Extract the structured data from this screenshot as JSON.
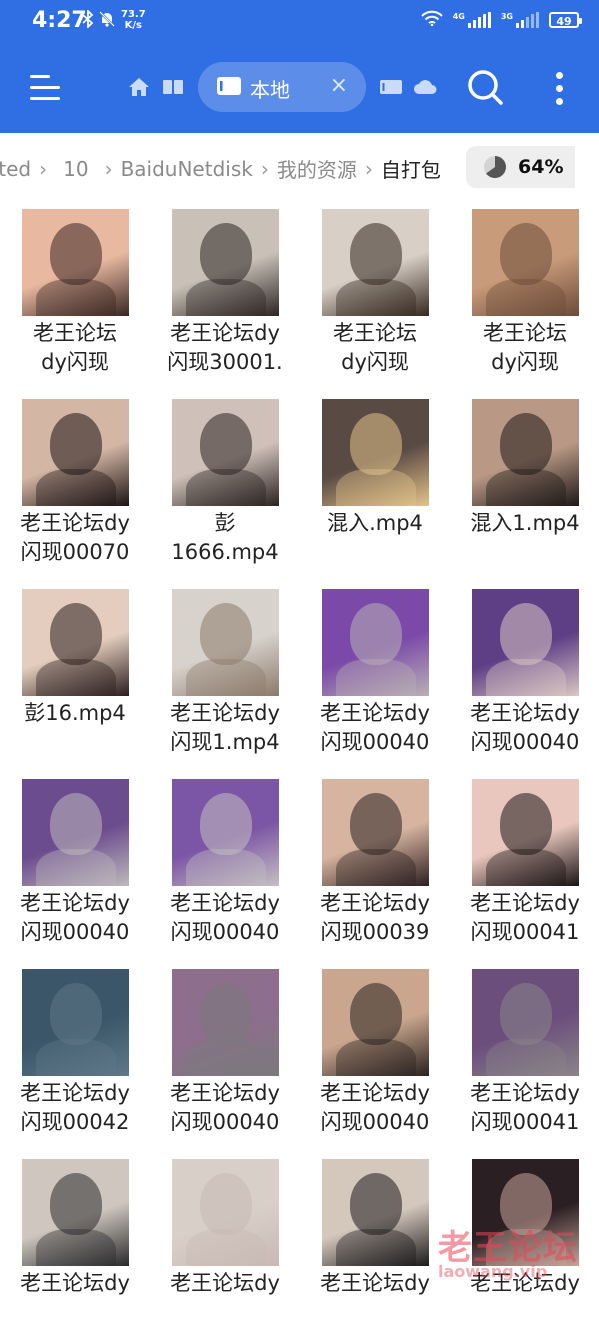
{
  "status_bar": {
    "time": "4:27",
    "net_speed_value": "73.7",
    "net_speed_unit": "K/s",
    "sim1_tag": "4G",
    "sim2_tag": "3G",
    "battery": "49"
  },
  "app_bar": {
    "active_tab_label": "本地",
    "tab_close": "×"
  },
  "breadcrumb": {
    "items": [
      "ated",
      "10",
      "BaiduNetdisk",
      "我的资源",
      "自打包"
    ],
    "separator": "›"
  },
  "storage": {
    "percent": "64%"
  },
  "files": [
    {
      "name_line1": "老王论坛",
      "name_line2": "dy闪现",
      "thumb": {
        "bg": "#e8b9a0",
        "fg": "#3a2622"
      }
    },
    {
      "name_line1": "老王论坛dy",
      "name_line2": "闪现30001.",
      "thumb": {
        "bg": "#c9c1b7",
        "fg": "#2c2624"
      }
    },
    {
      "name_line1": "老王论坛",
      "name_line2": "dy闪现",
      "thumb": {
        "bg": "#d8cfc6",
        "fg": "#35281f"
      }
    },
    {
      "name_line1": "老王论坛",
      "name_line2": "dy闪现",
      "thumb": {
        "bg": "#c89b7a",
        "fg": "#6c4b38"
      }
    },
    {
      "name_line1": "老王论坛dy",
      "name_line2": "闪现00070",
      "thumb": {
        "bg": "#d3b6a4",
        "fg": "#1d1414"
      }
    },
    {
      "name_line1": "彭",
      "name_line2": "1666.mp4",
      "thumb": {
        "bg": "#cfc1b9",
        "fg": "#2b2220"
      }
    },
    {
      "name_line1": "混入.mp4",
      "name_line2": "",
      "thumb": {
        "bg": "#5a4a44",
        "fg": "#e2c38a"
      }
    },
    {
      "name_line1": "混入1.mp4",
      "name_line2": "",
      "thumb": {
        "bg": "#b99985",
        "fg": "#1f1817"
      }
    },
    {
      "name_line1": "彭16.mp4",
      "name_line2": "",
      "thumb": {
        "bg": "#e4cdbe",
        "fg": "#2a1f1d"
      }
    },
    {
      "name_line1": "老王论坛dy",
      "name_line2": "闪现1.mp4",
      "thumb": {
        "bg": "#d7d2cc",
        "fg": "#8c7a6b"
      }
    },
    {
      "name_line1": "老王论坛dy",
      "name_line2": "闪现00040",
      "thumb": {
        "bg": "#7b4aa8",
        "fg": "#b8b0b4"
      }
    },
    {
      "name_line1": "老王论坛dy",
      "name_line2": "闪现00040",
      "thumb": {
        "bg": "#5e3f86",
        "fg": "#d9c7c2"
      }
    },
    {
      "name_line1": "老王论坛dy",
      "name_line2": "闪现00040",
      "thumb": {
        "bg": "#6b4c8f",
        "fg": "#bfb8bb"
      }
    },
    {
      "name_line1": "老王论坛dy",
      "name_line2": "闪现00040",
      "thumb": {
        "bg": "#7c56a6",
        "fg": "#c4bfc0"
      }
    },
    {
      "name_line1": "老王论坛dy",
      "name_line2": "闪现00039",
      "thumb": {
        "bg": "#d6b49f",
        "fg": "#2c2020"
      }
    },
    {
      "name_line1": "老王论坛dy",
      "name_line2": "闪现00041",
      "thumb": {
        "bg": "#e9c7be",
        "fg": "#1b1515"
      }
    },
    {
      "name_line1": "老王论坛dy",
      "name_line2": "闪现00042",
      "thumb": {
        "bg": "#3a5668",
        "fg": "#5f7989"
      }
    },
    {
      "name_line1": "老王论坛dy",
      "name_line2": "闪现00040",
      "thumb": {
        "bg": "#8d6e8c",
        "fg": "#7a7a7c"
      }
    },
    {
      "name_line1": "老王论坛dy",
      "name_line2": "闪现00040",
      "thumb": {
        "bg": "#c9a68d",
        "fg": "#2a2220"
      }
    },
    {
      "name_line1": "老王论坛dy",
      "name_line2": "闪现00041",
      "thumb": {
        "bg": "#6c4e7d",
        "fg": "#8a8588"
      }
    },
    {
      "name_line1": "老王论坛dy",
      "name_line2": "",
      "thumb": {
        "bg": "#cfc7bf",
        "fg": "#2a2a2c"
      }
    },
    {
      "name_line1": "老王论坛dy",
      "name_line2": "",
      "thumb": {
        "bg": "#d9cfc9",
        "fg": "#c7b9b3"
      }
    },
    {
      "name_line1": "老王论坛dy",
      "name_line2": "",
      "thumb": {
        "bg": "#d4c8bd",
        "fg": "#1c1a1b"
      }
    },
    {
      "name_line1": "老王论坛dy",
      "name_line2": "",
      "thumb": {
        "bg": "#2a1f22",
        "fg": "#c8a49a"
      }
    }
  ],
  "watermark": {
    "text": "老王论坛",
    "subtext": "laowang.vip"
  },
  "colors": {
    "app_bar": "#2f6fe3",
    "text": "#222222",
    "crumb_inactive": "#8a8a8a"
  }
}
